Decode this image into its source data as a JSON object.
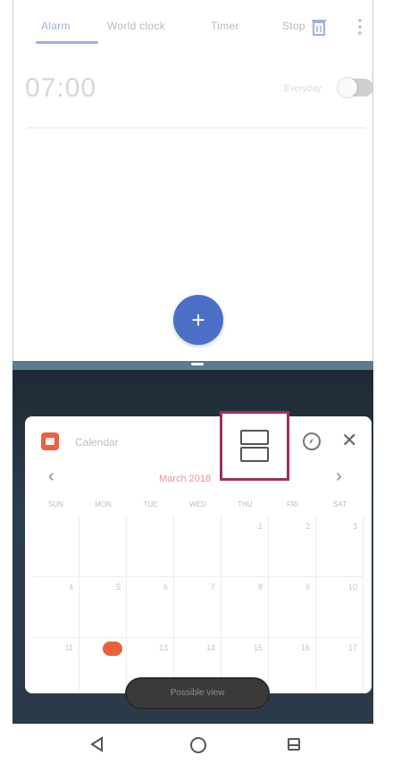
{
  "tabs": [
    {
      "label": "Alarm",
      "active": true
    },
    {
      "label": "World clock",
      "active": false
    },
    {
      "label": "Timer",
      "active": false
    },
    {
      "label": "Stopwatch",
      "active": false
    }
  ],
  "tab_icons": {
    "delete": "trash-icon",
    "more": "more-vert-icon"
  },
  "alarm": {
    "time": "07:00",
    "subtitle": "Everyday",
    "enabled": false
  },
  "fab": {
    "label": "+"
  },
  "calendar_popup": {
    "app_name": "Calendar",
    "month_label": "March 2018",
    "days_of_week": [
      "SUN",
      "MON",
      "TUE",
      "WED",
      "THU",
      "FRI",
      "SAT"
    ],
    "weeks": [
      [
        "",
        "",
        "",
        "",
        "1",
        "2",
        "3"
      ],
      [
        "4",
        "5",
        "6",
        "7",
        "8",
        "9",
        "10"
      ],
      [
        "11",
        "12",
        "13",
        "14",
        "15",
        "16",
        "17"
      ]
    ],
    "today": "12"
  },
  "pill": {
    "label": "Possible view"
  },
  "nav": {
    "back": "back-icon",
    "home": "home-icon",
    "recents": "split-view-icon"
  },
  "colors": {
    "accent": "#4d6fc8",
    "highlight_border": "#9c2f60",
    "today": "#e8623f"
  }
}
